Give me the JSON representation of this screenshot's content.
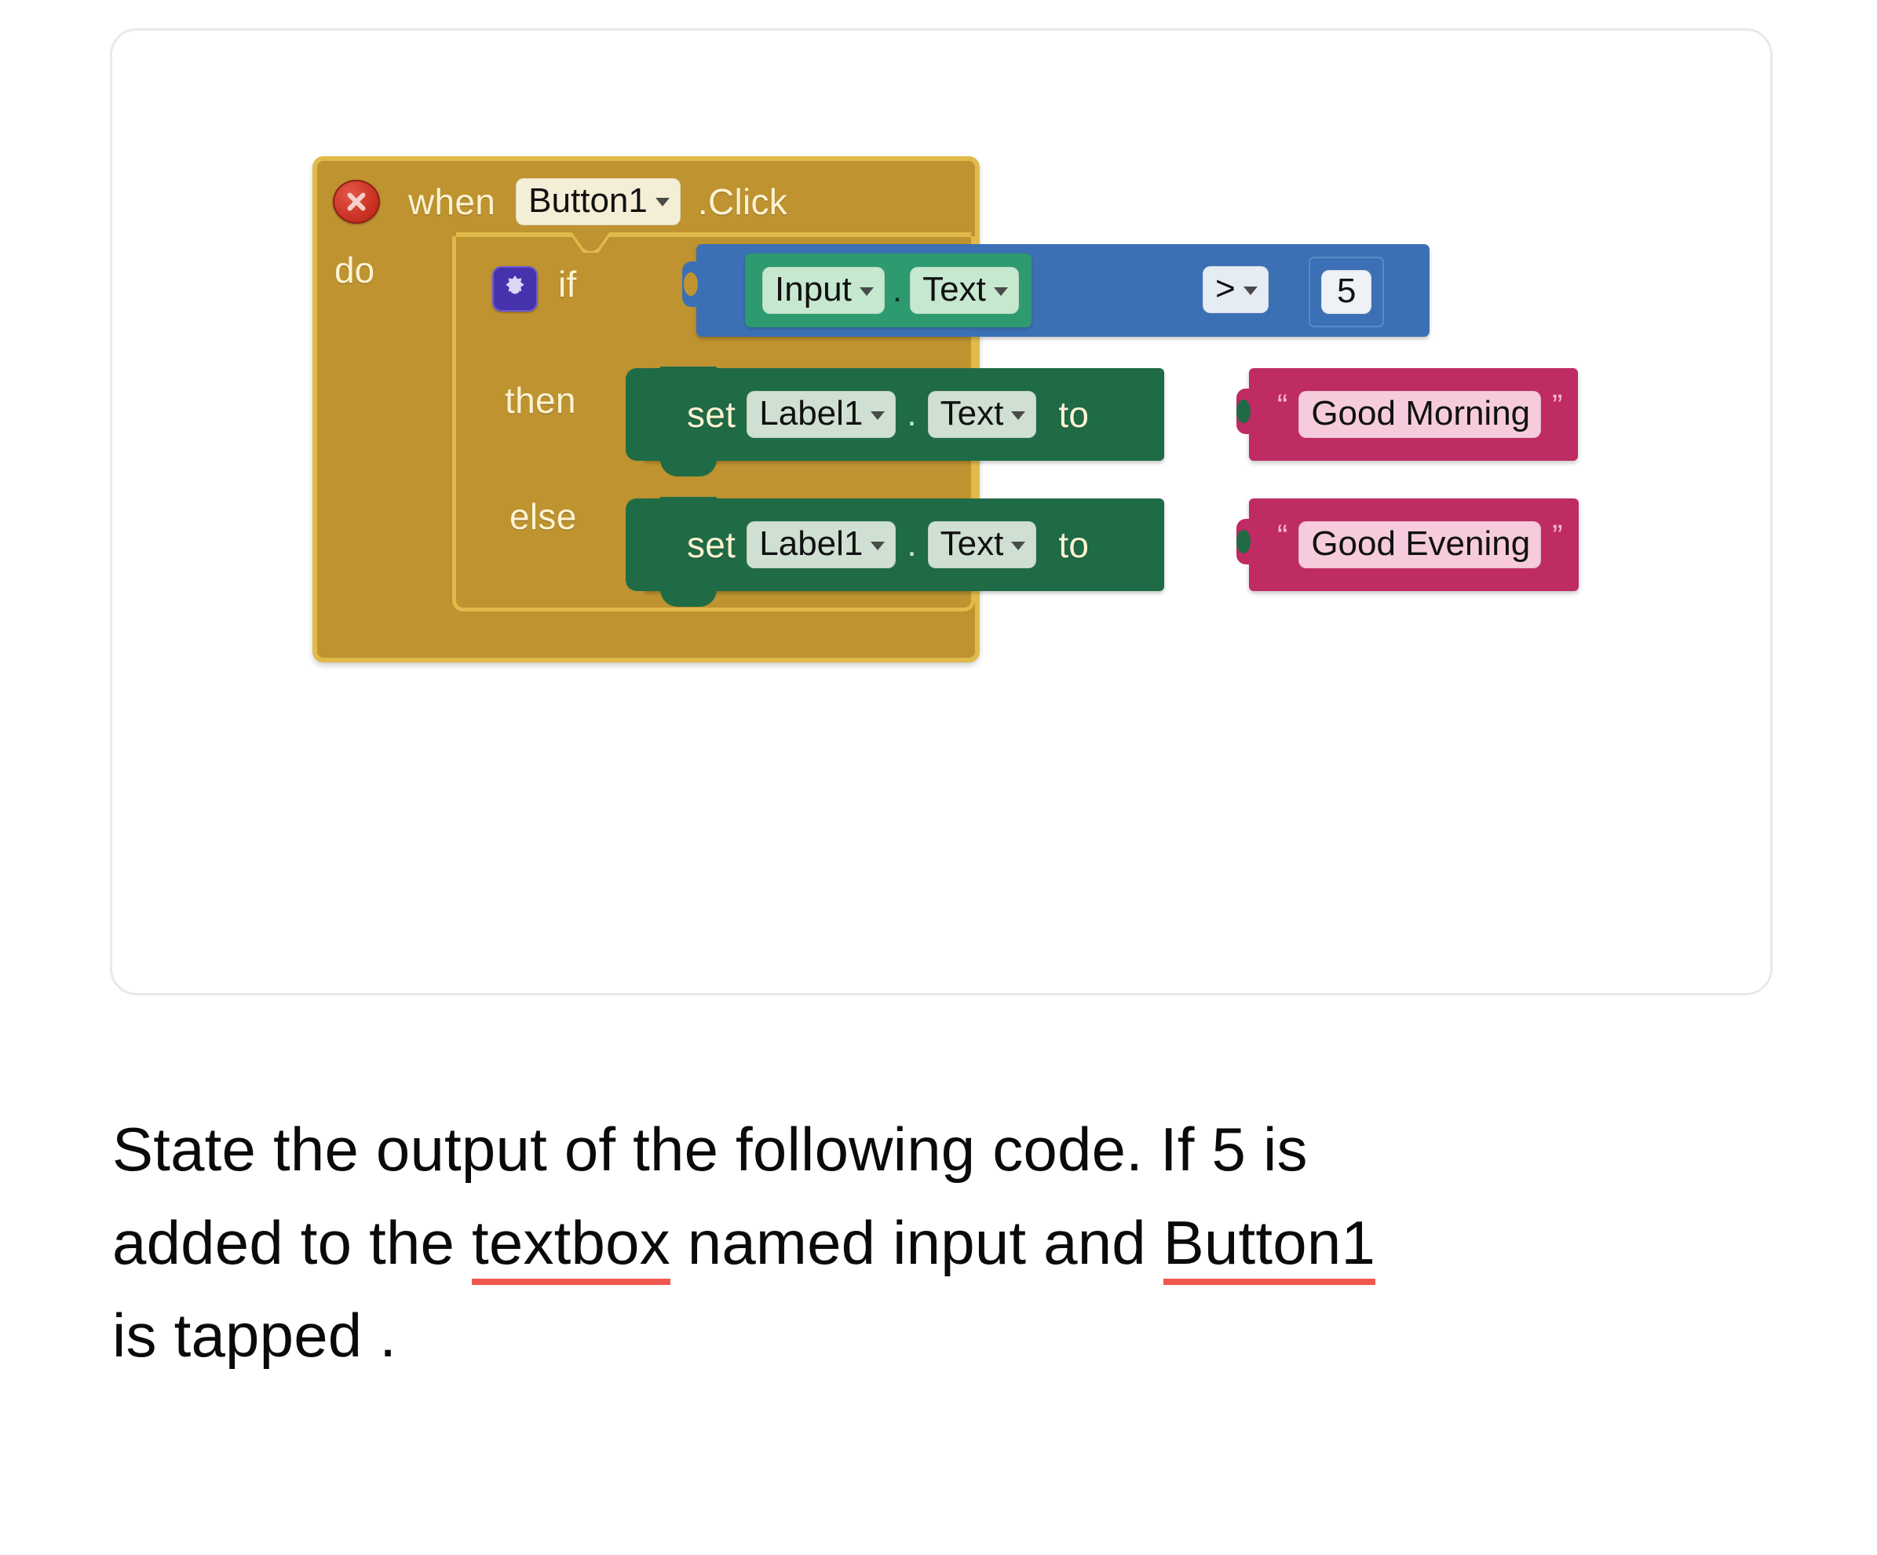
{
  "card": {
    "accent_yellow": "#BE9330",
    "accent_yellow_border": "#E0BB4A",
    "accent_blue": "#3C70B4",
    "accent_green_getter": "#2E9A70",
    "accent_green_setter": "#1F6B46",
    "accent_pink": "#BF2B63",
    "gear_purple": "#4632AD",
    "close_red": "#C42B1C",
    "underline_red": "#F0574F"
  },
  "blocks": {
    "event": {
      "close_icon": "close-x-icon",
      "when_label": "when",
      "component": "Button1",
      "event_name": ".Click",
      "do_label": "do"
    },
    "control": {
      "mutator_icon": "gear-icon",
      "if_label": "if",
      "then_label": "then",
      "else_label": "else"
    },
    "condition": {
      "component": "Input",
      "property": "Text",
      "dot": ".",
      "operator": ">",
      "number": "5"
    },
    "then_statement": {
      "set_label": "set",
      "component": "Label1",
      "property": "Text",
      "dot": ".",
      "to_label": "to",
      "value": "Good Morning",
      "open_quote": "“",
      "close_quote": "”"
    },
    "else_statement": {
      "set_label": "set",
      "component": "Label1",
      "property": "Text",
      "dot": ".",
      "to_label": "to",
      "value": "Good Evening",
      "open_quote": "“",
      "close_quote": "”"
    }
  },
  "question": {
    "line1": "State the output of the following code.  If 5 is",
    "line2_a": "added to the ",
    "line2_underline1": "textbox",
    "line2_b": "  named input and ",
    "line2_underline2": "Button1",
    "line3": "is tapped ."
  }
}
